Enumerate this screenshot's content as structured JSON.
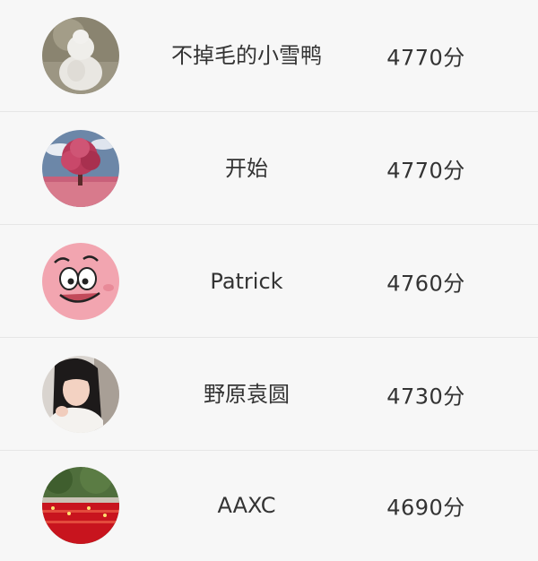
{
  "leaderboard": {
    "rows": [
      {
        "name": "不掉毛的小雪鸭",
        "score": "4770分",
        "avatar_icon": "snowman-avatar-icon"
      },
      {
        "name": "开始",
        "score": "4770分",
        "avatar_icon": "pink-tree-avatar-icon"
      },
      {
        "name": "Patrick",
        "score": "4760分",
        "avatar_icon": "patrick-star-avatar-icon"
      },
      {
        "name": "野原袁圆",
        "score": "4730分",
        "avatar_icon": "girl-photo-avatar-icon"
      },
      {
        "name": "AAXC",
        "score": "4690分",
        "avatar_icon": "red-garden-avatar-icon"
      }
    ]
  },
  "colors": {
    "background": "#f7f7f7",
    "divider": "#e6e6e6",
    "text": "#333333"
  }
}
